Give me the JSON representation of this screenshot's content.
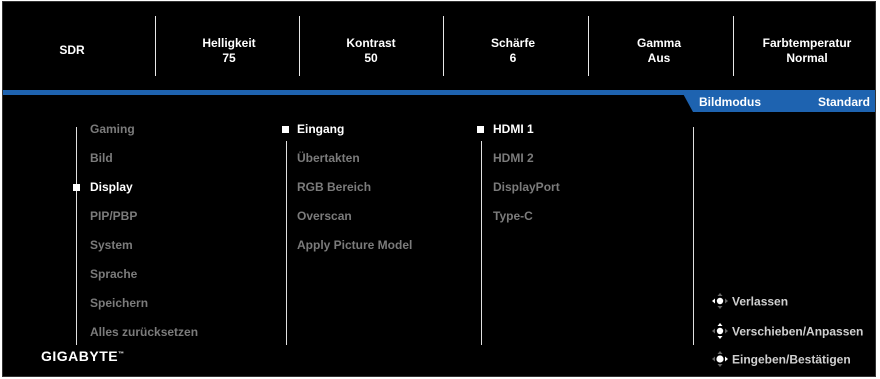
{
  "topbar": {
    "items": [
      {
        "label": "SDR",
        "value": ""
      },
      {
        "label": "Helligkeit",
        "value": "75"
      },
      {
        "label": "Kontrast",
        "value": "50"
      },
      {
        "label": "Schärfe",
        "value": "6"
      },
      {
        "label": "Gamma",
        "value": "Aus"
      },
      {
        "label": "Farbtemperatur",
        "value": "Normal"
      }
    ]
  },
  "tab": {
    "label": "Bildmodus",
    "value": "Standard"
  },
  "menu": {
    "main": [
      "Gaming",
      "Bild",
      "Display",
      "PIP/PBP",
      "System",
      "Sprache",
      "Speichern",
      "Alles zurücksetzen"
    ],
    "main_selected": "Display",
    "sub": [
      "Eingang",
      "Übertakten",
      "RGB Bereich",
      "Overscan",
      "Apply Picture Model"
    ],
    "sub_selected": "Eingang",
    "options": [
      "HDMI 1",
      "HDMI 2",
      "DisplayPort",
      "Type-C"
    ],
    "options_selected": "HDMI 1"
  },
  "hints": {
    "exit": "Verlassen",
    "move": "Verschieben/Anpassen",
    "enter": "Eingeben/Bestätigen"
  },
  "brand": {
    "logo": "GIGABYTE"
  },
  "colors": {
    "accent": "#1e63b0",
    "background": "#000000",
    "dimmed_text": "#7b7b7b",
    "selected_text": "#ffffff"
  }
}
